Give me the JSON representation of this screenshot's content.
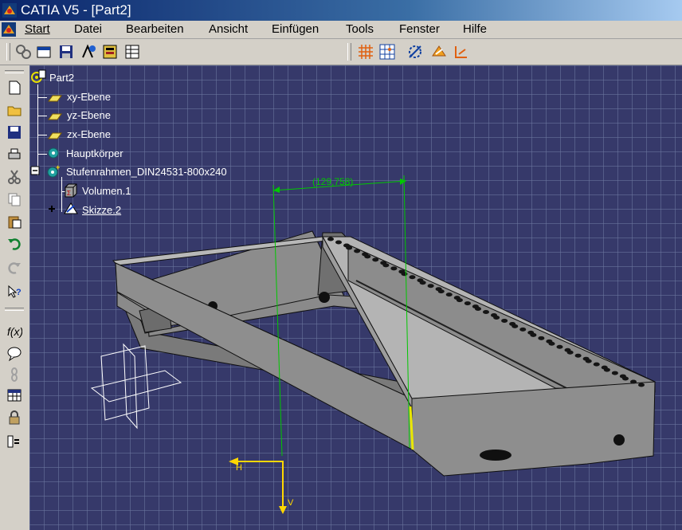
{
  "window": {
    "title": "CATIA V5 - [Part2]"
  },
  "menu": [
    {
      "label": "Start"
    },
    {
      "label": "Datei"
    },
    {
      "label": "Bearbeiten"
    },
    {
      "label": "Ansicht"
    },
    {
      "label": "Einfügen"
    },
    {
      "label": "Tools"
    },
    {
      "label": "Fenster"
    },
    {
      "label": "Hilfe"
    }
  ],
  "tree": {
    "root": "Part2",
    "items": [
      {
        "label": "xy-Ebene",
        "icon": "plane-icon"
      },
      {
        "label": "yz-Ebene",
        "icon": "plane-icon"
      },
      {
        "label": "zx-Ebene",
        "icon": "plane-icon"
      },
      {
        "label": "Hauptkörper",
        "icon": "body-gear-icon"
      },
      {
        "label": "Stufenrahmen_DIN24531-800x240",
        "icon": "body-gear-icon"
      },
      {
        "label": "Volumen.1",
        "icon": "volume-icon"
      },
      {
        "label": "Skizze.2",
        "icon": "sketch-icon"
      }
    ]
  },
  "viewport": {
    "dimension": "(129,758)",
    "axis_h": "H",
    "axis_v": "V"
  },
  "colors": {
    "background": "#36396a",
    "grid": "#6e78a0",
    "dimension": "#00c800",
    "axis": "#ffd700",
    "part": "#8c8c8c"
  }
}
